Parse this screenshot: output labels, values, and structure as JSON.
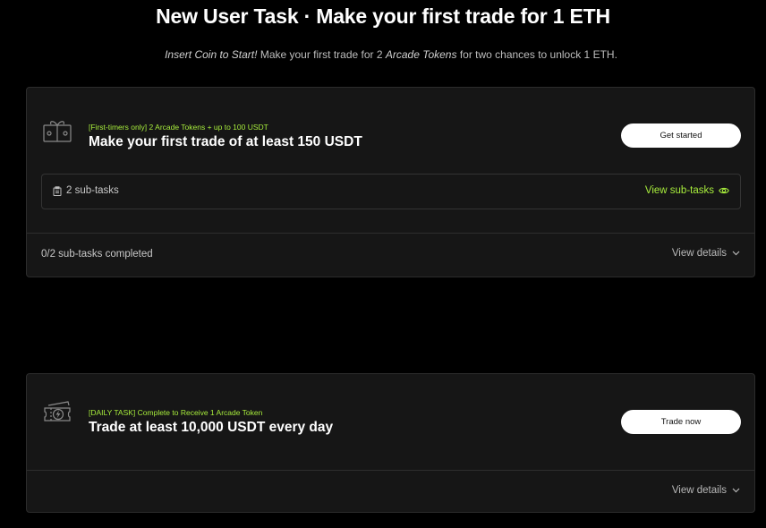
{
  "header": {
    "title": "New User Task · Make your first trade for 1 ETH",
    "subtitle_em1": "Insert Coin to Start!",
    "subtitle_mid": " Make your first trade for 2 ",
    "subtitle_em2": "Arcade Tokens",
    "subtitle_end": " for two chances to unlock 1 ETH."
  },
  "task1": {
    "icon": "gift-icon",
    "tag": "[First-timers only] 2 Arcade Tokens + up to 100 USDT",
    "title": "Make your first trade of at least 150 USDT",
    "button": "Get started",
    "subtasks_label": "2 sub-tasks",
    "view_subtasks": "View sub-tasks",
    "progress": "0/2 sub-tasks completed",
    "details": "View details"
  },
  "task2": {
    "icon": "ticket-icon",
    "tag": "[DAILY TASK] Complete to Receive 1 Arcade Token",
    "title": "Trade at least 10,000 USDT every day",
    "button": "Trade now",
    "details": "View details"
  },
  "colors": {
    "accent": "#a8ee3c",
    "card_bg": "#161616",
    "page_bg": "#000000"
  }
}
